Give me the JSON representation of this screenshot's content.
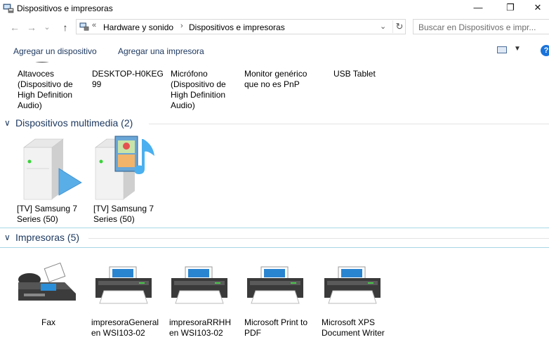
{
  "window": {
    "title": "Dispositivos e impresoras",
    "minimize": "—",
    "maximize": "❐",
    "close": "✕"
  },
  "nav": {
    "back": "←",
    "forward": "→",
    "recent": "⌄",
    "up": "↑"
  },
  "address": {
    "overflow": "«",
    "crumbs": [
      "Hardware y sonido",
      "Dispositivos e impresoras"
    ],
    "separator": "›",
    "dropdown": "⌄",
    "refresh": "↻"
  },
  "search": {
    "placeholder": "Buscar en Dispositivos e impr..."
  },
  "commands": {
    "add_device": "Agregar un dispositivo",
    "add_printer": "Agregar una impresora",
    "view_dropdown": "▼",
    "help": "?"
  },
  "devices_top": [
    {
      "label": "Altavoces\n(Dispositivo de\nHigh Definition\nAudio)"
    },
    {
      "label": "DESKTOP-H0KEG\n99"
    },
    {
      "label": "Micrófono\n(Dispositivo de\nHigh Definition\nAudio)"
    },
    {
      "label": "Monitor genérico\nque no es PnP"
    },
    {
      "label": "USB Tablet"
    }
  ],
  "multimedia": {
    "chevron": "∨",
    "title": "Dispositivos multimedia (2)",
    "items": [
      {
        "label": "[TV] Samsung 7\nSeries (50)"
      },
      {
        "label": "[TV] Samsung 7\nSeries (50)"
      }
    ]
  },
  "printers": {
    "chevron": "∨",
    "title": "Impresoras (5)",
    "items": [
      {
        "label": "Fax"
      },
      {
        "label": "impresoraGeneral\nen WSI103-02"
      },
      {
        "label": "impresoraRRHH\nen WSI103-02"
      },
      {
        "label": "Microsoft Print to\nPDF"
      },
      {
        "label": "Microsoft XPS\nDocument Writer"
      }
    ]
  },
  "colors": {
    "header_text": "#1e3960",
    "accent": "#1a73d9"
  }
}
